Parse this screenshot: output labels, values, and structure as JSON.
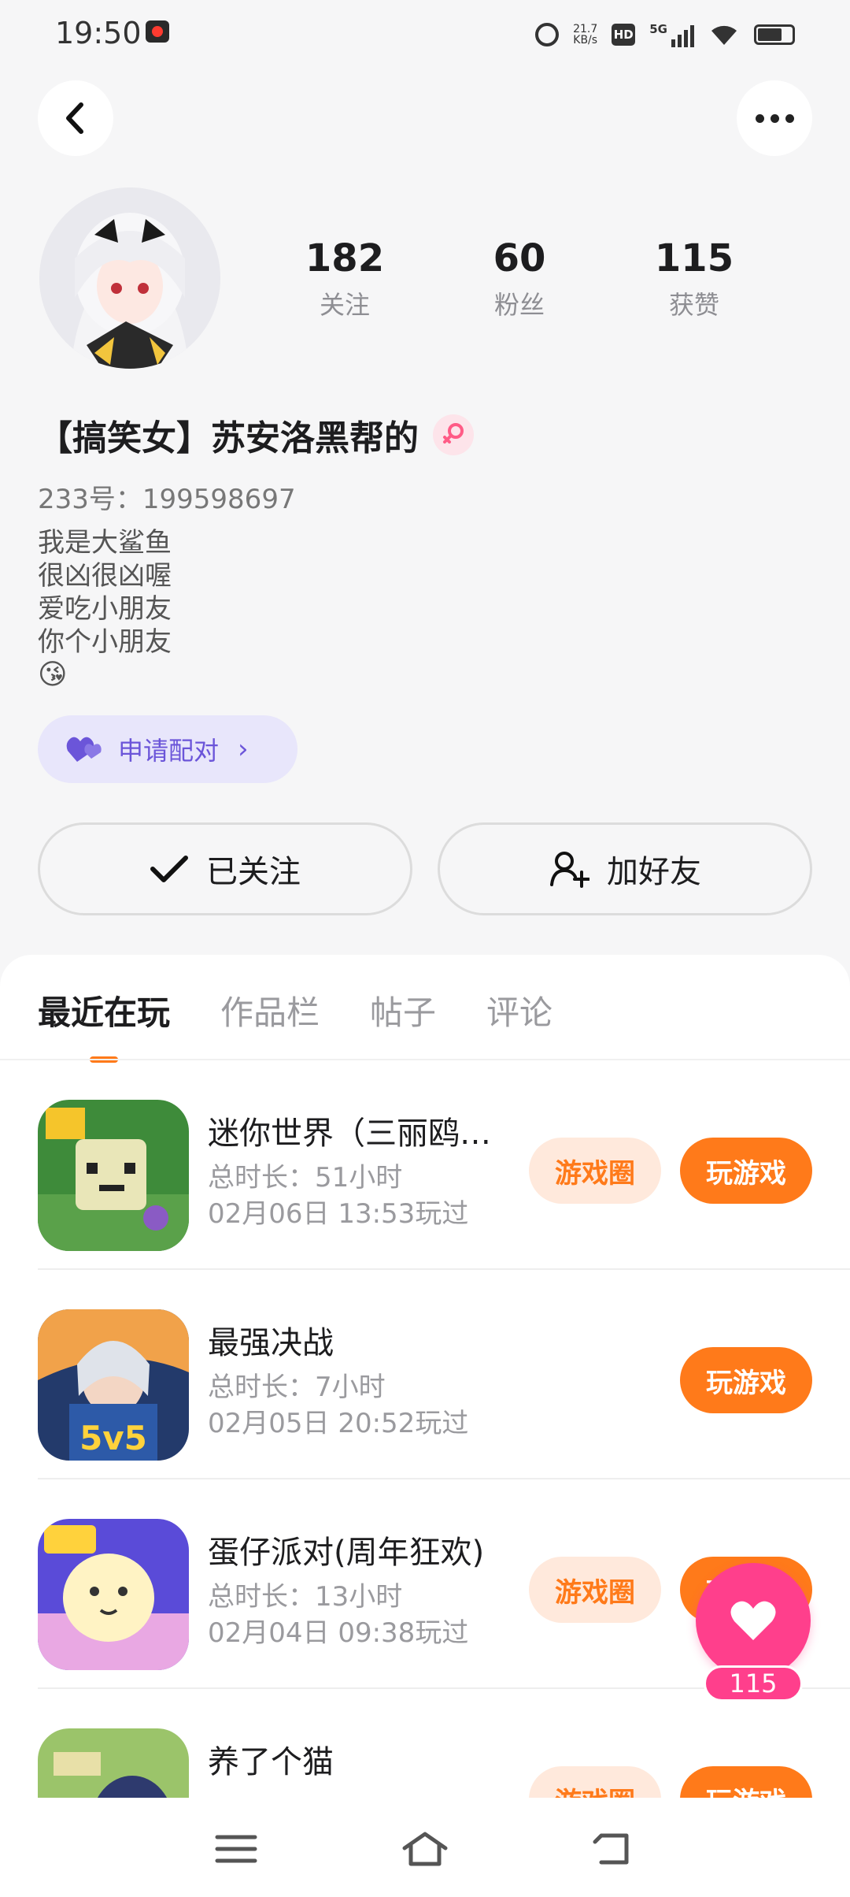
{
  "status_bar": {
    "time": "19:50",
    "net_speed_value": "21.7",
    "net_speed_unit": "KB/s",
    "hd_label": "HD",
    "signal_label": "5G"
  },
  "profile": {
    "name": "【搞笑女】苏安洛黑帮的",
    "uid_text": "233号：199598697",
    "bio_lines": [
      "我是大鲨鱼",
      "很凶很凶喔",
      "爱吃小朋友",
      "你个小朋友"
    ],
    "bio_emoji": "😘",
    "stats": [
      {
        "value": "182",
        "label": "关注"
      },
      {
        "value": "60",
        "label": "粉丝"
      },
      {
        "value": "115",
        "label": "获赞"
      }
    ]
  },
  "actions": {
    "pair_label": "申请配对",
    "followed_label": "已关注",
    "add_friend_label": "加好友"
  },
  "tabs": [
    {
      "label": "最近在玩",
      "active": true
    },
    {
      "label": "作品栏",
      "active": false
    },
    {
      "label": "帖子",
      "active": false
    },
    {
      "label": "评论",
      "active": false
    }
  ],
  "games": [
    {
      "title": "迷你世界（三丽鸥…",
      "duration": "总时长：51小时",
      "last_played": "02月06日 13:53玩过",
      "has_circle": true
    },
    {
      "title": "最强决战",
      "duration": "总时长：7小时",
      "last_played": "02月05日 20:52玩过",
      "has_circle": false
    },
    {
      "title": "蛋仔派对(周年狂欢)",
      "duration": "总时长：13小时",
      "last_played": "02月04日 09:38玩过",
      "has_circle": true
    },
    {
      "title": "养了个猫",
      "duration": "",
      "last_played": "",
      "has_circle": true
    }
  ],
  "buttons": {
    "game_circle_label": "游戏圈",
    "play_label": "玩游戏"
  },
  "like_count": "115",
  "colors": {
    "accent_orange": "#ff7a1a",
    "pair_purple": "#6b55d9",
    "like_pink": "#ff3f8c"
  }
}
